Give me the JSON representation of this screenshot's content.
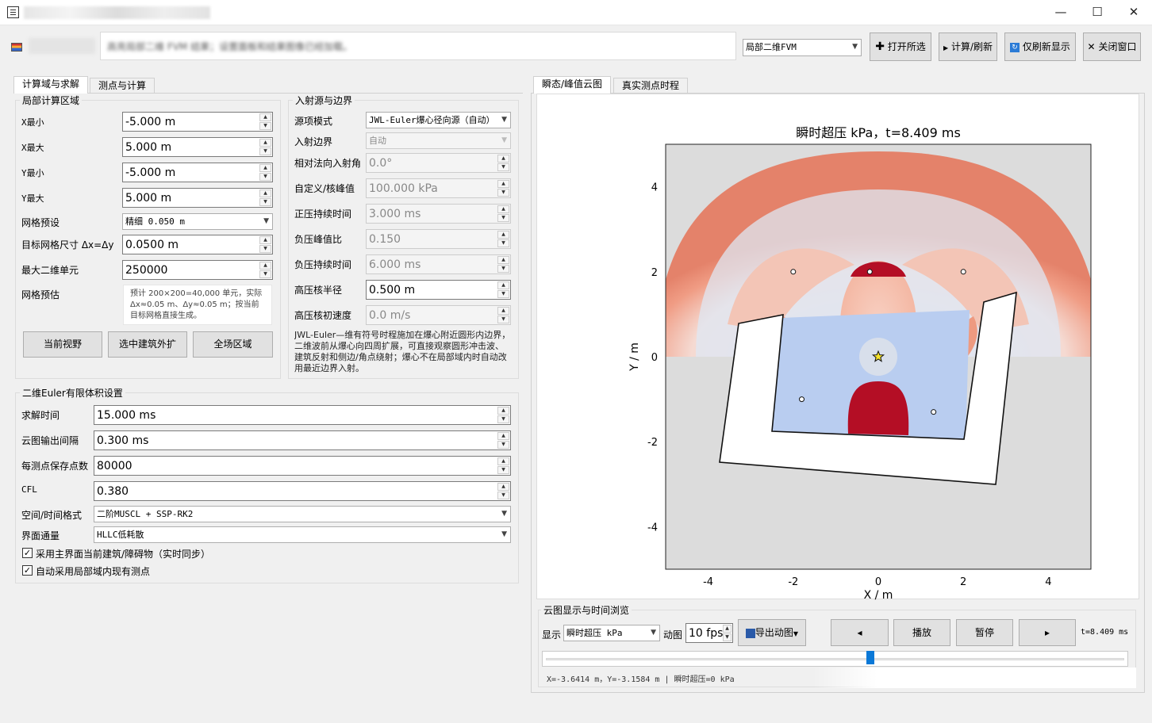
{
  "window": {
    "minimize": "—",
    "maximize": "☐",
    "close": "✕"
  },
  "header": {
    "mode_select": "局部二维FVM",
    "buttons": {
      "open": "打开所选",
      "compute": "计算/刷新",
      "refresh_display": "仅刷新显示",
      "close": "关闭窗口"
    },
    "info_text": "高亮局部二维 FVM 结果；设置面板和结果图像已经加载。"
  },
  "left_tabs": [
    "计算域与求解",
    "测点与计算"
  ],
  "domain_group": {
    "title": "局部计算区域",
    "xmin_label": "X最小",
    "xmin": "-5.000 m",
    "xmax_label": "X最大",
    "xmax": "5.000 m",
    "ymin_label": "Y最小",
    "ymin": "-5.000 m",
    "ymax_label": "Y最大",
    "ymax": "5.000 m",
    "mesh_preset_label": "网格预设",
    "mesh_preset": "精细 0.050 m",
    "target_size_label": "目标网格尺寸 Δx=Δy",
    "target_size": "0.0500 m",
    "max_cells_label": "最大二维单元",
    "max_cells": "250000",
    "mesh_estimate_label": "网格预估",
    "mesh_estimate": "预计 200×200=40,000 单元，实际 Δx≈0.05 m、Δy≈0.05 m；按当前目标网格直接生成。",
    "btn_view": "当前视野",
    "btn_building": "选中建筑外扩",
    "btn_all": "全场区域"
  },
  "source_group": {
    "title": "入射源与边界",
    "mode_label": "源项模式",
    "mode": "JWL-Euler爆心径向源（自动）",
    "boundary_label": "入射边界",
    "boundary": "自动",
    "angle_label": "相对法向入射角",
    "angle": "0.0°",
    "peak_label": "自定义/核峰值",
    "peak": "100.000 kPa",
    "pos_dur_label": "正压持续时间",
    "pos_dur": "3.000 ms",
    "neg_ratio_label": "负压峰值比",
    "neg_ratio": "0.150",
    "neg_dur_label": "负压持续时间",
    "neg_dur": "6.000 ms",
    "core_radius_label": "高压核半径",
    "core_radius": "0.500 m",
    "core_vel_label": "高压核初速度",
    "core_vel": "0.0 m/s",
    "note": "JWL-Euler—维有符号时程施加在爆心附近圆形内边界，二维波前从爆心向四周扩展，可直接观察圆形冲击波、建筑反射和侧边/角点绕射；爆心不在局部域内时自动改用最近边界入射。"
  },
  "euler_group": {
    "title": "二维Euler有限体积设置",
    "time_label": "求解时间",
    "time": "15.000 ms",
    "interval_label": "云图输出间隔",
    "interval": "0.300 ms",
    "points_label": "每测点保存点数",
    "points": "80000",
    "cfl_label": "CFL",
    "cfl": "0.380",
    "scheme_label": "空间/时间格式",
    "scheme": "二阶MUSCL + SSP-RK2",
    "flux_label": "界面通量",
    "flux": "HLLC低耗散",
    "chk1": "采用主界面当前建筑/障碍物（实时同步）",
    "chk2": "自动采用局部域内现有测点"
  },
  "right_tabs": [
    "瞬态/峰值云图",
    "真实测点时程"
  ],
  "chart_data": {
    "type": "heatmap",
    "title": "瞬时超压 kPa，t=8.409 ms",
    "xlabel": "X / m",
    "ylabel": "Y / m",
    "xlim": [
      -5,
      5
    ],
    "ylim": [
      -5,
      5
    ],
    "xticks": [
      "-4",
      "-2",
      "0",
      "2",
      "4"
    ],
    "yticks": [
      "4",
      "2",
      "0",
      "-2",
      "-4"
    ],
    "source": [
      0,
      0
    ],
    "probes": [
      [
        -2,
        2
      ],
      [
        2,
        2
      ],
      [
        -0.2,
        2
      ],
      [
        -1.8,
        -1
      ],
      [
        1.3,
        -1.3
      ]
    ]
  },
  "playback": {
    "group_title": "云图显示与时间浏览",
    "display_label": "显示",
    "display": "瞬时超压 kPa",
    "anim_label": "动图",
    "fps": "10 fps",
    "export": "导出动图",
    "prev": "◂",
    "play": "播放",
    "pause": "暂停",
    "next": "▸",
    "time": "t=8.409 ms",
    "progress": 0.56,
    "status": "X=-3.6414 m，Y=-3.1584 m  |  瞬时超压=0 kPa"
  }
}
